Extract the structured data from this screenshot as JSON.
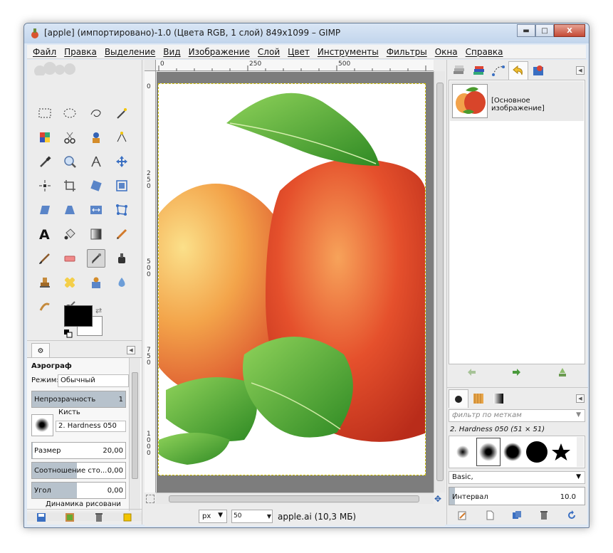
{
  "window": {
    "title": "[apple] (импортировано)-1.0 (Цвета RGB, 1 слой) 849x1099 – GIMP",
    "minimize": "▬",
    "maximize": "□",
    "close": "X"
  },
  "menu": [
    "Файл",
    "Правка",
    "Выделение",
    "Вид",
    "Изображение",
    "Слой",
    "Цвет",
    "Инструменты",
    "Фильтры",
    "Окна",
    "Справка"
  ],
  "tool_options": {
    "title": "Аэрограф",
    "mode_label": "Режим:",
    "mode_value": "Обычный",
    "opacity_label": "Непрозрачность",
    "opacity_value": "1",
    "brush_label": "Кисть",
    "brush_name": "2. Hardness 050",
    "size_label": "Размер",
    "size_value": "20,00",
    "ratio_label": "Соотношение сто...",
    "ratio_value": "0,00",
    "angle_label": "Угол",
    "angle_value": "0,00",
    "dynamics_label": "Динамика рисовани"
  },
  "rulers": {
    "h_ticks": [
      "0",
      "250",
      "500"
    ],
    "v_ticks": [
      "0",
      "2\n5\n0",
      "5\n0\n0",
      "7\n5\n0",
      "1\n0\n0\n0"
    ]
  },
  "status": {
    "unit": "px",
    "zoom": "50",
    "file": "apple.ai (10,3 МБ)"
  },
  "layers": {
    "layer_name": "[Основное изображение]"
  },
  "brushes": {
    "filter_placeholder": "фильтр по меткам",
    "current": "2. Hardness 050 (51 × 51)",
    "tag": "Basic,",
    "interval_label": "Интервал",
    "interval_value": "10.0"
  }
}
